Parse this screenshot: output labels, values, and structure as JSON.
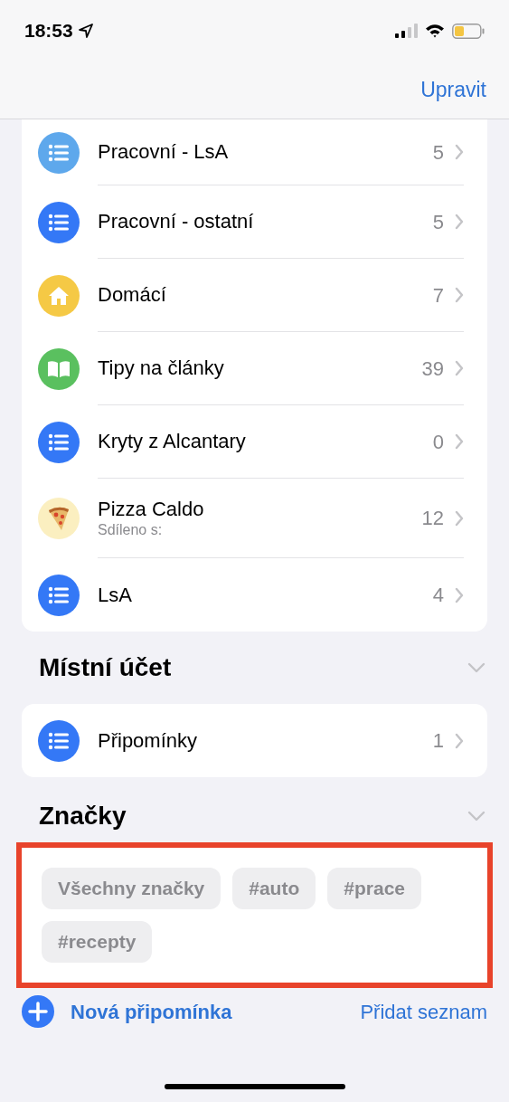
{
  "status_bar": {
    "time": "18:53"
  },
  "nav": {
    "action": "Upravit"
  },
  "lists": [
    {
      "kind": "list",
      "color": "#5ea8ec",
      "name": "Pracovní - LsA",
      "count": "5"
    },
    {
      "kind": "list",
      "color": "#3478f6",
      "name": "Pracovní - ostatní",
      "count": "5"
    },
    {
      "kind": "home",
      "color": "#f5c945",
      "name": "Domácí",
      "count": "7"
    },
    {
      "kind": "book",
      "color": "#5ac05f",
      "name": "Tipy na články",
      "count": "39"
    },
    {
      "kind": "list",
      "color": "#3478f6",
      "name": "Kryty z Alcantary",
      "count": "0"
    },
    {
      "kind": "pizza",
      "color": "#fbefc0",
      "name": "Pizza Caldo",
      "subtitle": "Sdíleno s:",
      "count": "12"
    },
    {
      "kind": "list",
      "color": "#3478f6",
      "name": "LsA",
      "count": "4"
    }
  ],
  "local_account": {
    "title": "Místní účet",
    "lists": [
      {
        "kind": "list",
        "color": "#3478f6",
        "name": "Připomínky",
        "count": "1"
      }
    ]
  },
  "tags": {
    "title": "Značky",
    "highlighted": true,
    "items": [
      "Všechny značky",
      "#auto",
      "#prace",
      "#recepty"
    ]
  },
  "toolbar": {
    "new_reminder": "Nová připomínka",
    "add_list": "Přidat seznam"
  }
}
